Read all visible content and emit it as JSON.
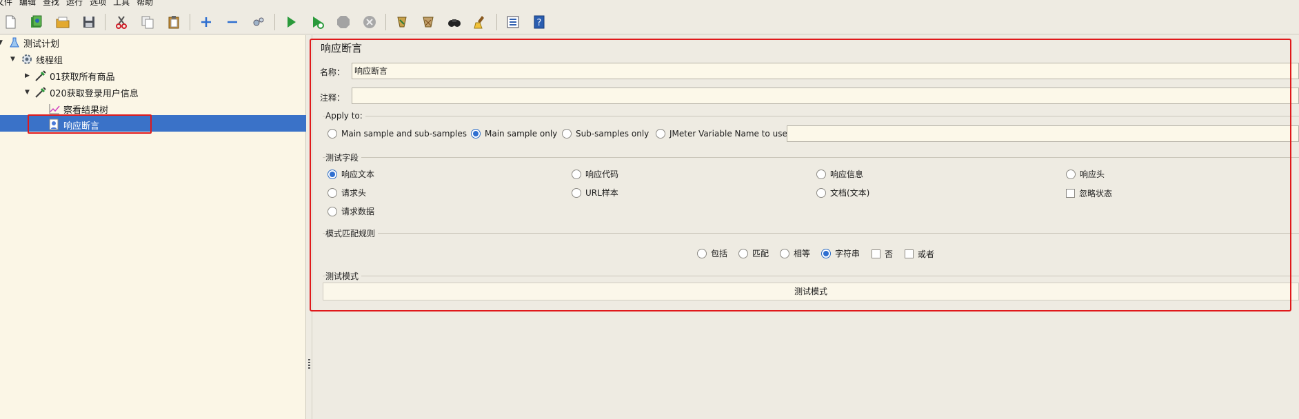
{
  "menu": [
    "文件",
    "编辑",
    "查找",
    "运行",
    "选项",
    "工具",
    "帮助"
  ],
  "toolbar": [
    {
      "icon": "new-file-icon"
    },
    {
      "icon": "templates-icon"
    },
    {
      "icon": "open-icon"
    },
    {
      "icon": "save-icon"
    },
    {
      "sep": true
    },
    {
      "icon": "cut-icon"
    },
    {
      "icon": "copy-icon"
    },
    {
      "icon": "paste-icon"
    },
    {
      "sep": true
    },
    {
      "icon": "expand-icon"
    },
    {
      "icon": "collapse-icon"
    },
    {
      "icon": "toggle-icon"
    },
    {
      "sep": true
    },
    {
      "icon": "start-icon"
    },
    {
      "icon": "start-no-pause-icon"
    },
    {
      "icon": "stop-icon"
    },
    {
      "icon": "shutdown-icon"
    },
    {
      "sep": true
    },
    {
      "icon": "remote-icon"
    },
    {
      "icon": "clear-icon"
    },
    {
      "icon": "search-icon"
    },
    {
      "icon": "clear-all-icon"
    },
    {
      "sep": true
    },
    {
      "icon": "function-helper-icon"
    },
    {
      "icon": "help-icon"
    }
  ],
  "tree": {
    "test_plan": "测试计划",
    "thread_group": "线程组",
    "sampler1": "01获取所有商品",
    "sampler2": "020获取登录用户信息",
    "results_tree": "察看结果树",
    "assertion": "响应断言"
  },
  "panel": {
    "title": "响应断言",
    "name_label": "名称：",
    "name_value": "响应断言",
    "comment_label": "注释：",
    "comment_value": "",
    "apply_to": {
      "title": "Apply to:",
      "options": [
        "Main sample and sub-samples",
        "Main sample only",
        "Sub-samples only",
        "JMeter Variable Name to use"
      ],
      "selected": "Main sample only",
      "variable_value": ""
    },
    "field_to_test": {
      "title": "测试字段",
      "options": [
        "响应文本",
        "响应代码",
        "响应信息",
        "响应头",
        "请求头",
        "URL样本",
        "文档(文本)",
        "忽略状态",
        "请求数据"
      ],
      "selected": "响应文本"
    },
    "pattern_rules": {
      "title": "模式匹配规则",
      "options": [
        "包括",
        "匹配",
        "相等",
        "字符串",
        "否",
        "或者"
      ],
      "selected": "字符串"
    },
    "patterns": {
      "title": "测试模式",
      "column": "测试模式"
    }
  },
  "colors": {
    "accent": "#3a72c8",
    "highlight_box": "#e0191b",
    "background": "#eeebe2",
    "tree_background": "#fbf6e6"
  }
}
